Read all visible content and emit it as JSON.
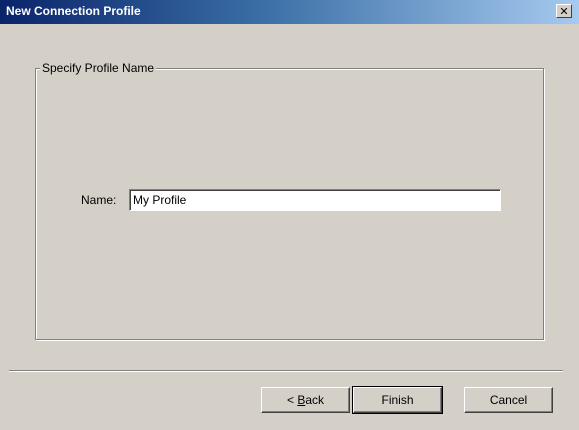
{
  "window": {
    "title": "New Connection Profile",
    "close_glyph": "✕"
  },
  "group": {
    "legend": "Specify Profile Name"
  },
  "form": {
    "name_label": "Name:",
    "name_value": "My Profile"
  },
  "buttons": {
    "back_prefix": "< ",
    "back_mnemonic": "B",
    "back_rest": "ack",
    "finish": "Finish",
    "cancel": "Cancel"
  },
  "colors": {
    "titlebar_start": "#0a246a",
    "titlebar_end": "#a6caf0",
    "dialog_face": "#d4d0c8"
  }
}
